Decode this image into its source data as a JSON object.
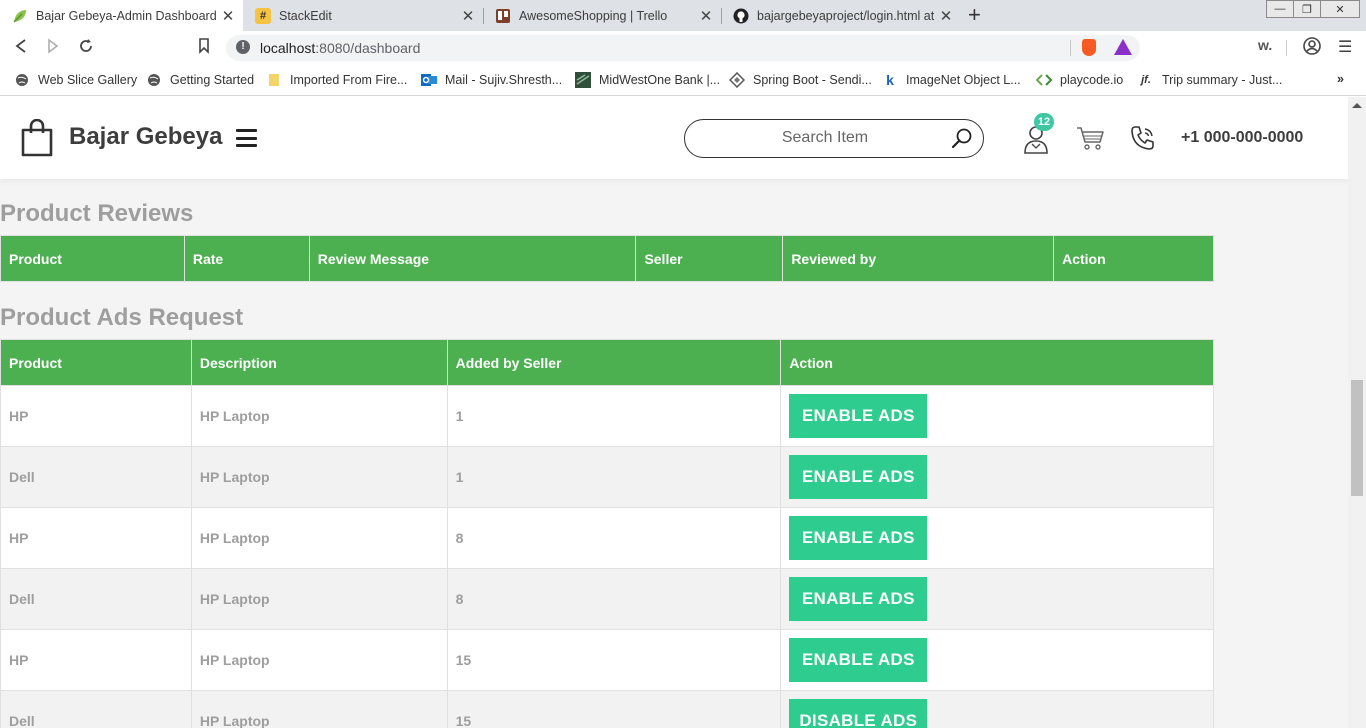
{
  "browser": {
    "tabs": [
      {
        "title": "Bajar Gebeya-Admin Dashboard",
        "icon": "leaf-icon",
        "active": true
      },
      {
        "title": "StackEdit",
        "icon": "hash-icon",
        "active": false
      },
      {
        "title": "AwesomeShopping | Trello",
        "icon": "trello-icon",
        "active": false
      },
      {
        "title": "bajargebeyaproject/login.html at d",
        "icon": "github-icon",
        "active": false
      }
    ],
    "url_host": "localhost",
    "url_path": ":8080/dashboard",
    "bookmarks": [
      {
        "label": "Web Slice Gallery",
        "icon": "globe-icon"
      },
      {
        "label": "Getting Started",
        "icon": "globe-icon"
      },
      {
        "label": "Imported From Fire...",
        "icon": "folder-icon"
      },
      {
        "label": "Mail - Sujiv.Shresth...",
        "icon": "outlook-icon"
      },
      {
        "label": "MidWestOne Bank |...",
        "icon": "bank-icon"
      },
      {
        "label": "Spring Boot - Sendi...",
        "icon": "diamond-icon"
      },
      {
        "label": "ImageNet Object L...",
        "icon": "k-icon"
      },
      {
        "label": "playcode.io",
        "icon": "code-icon"
      },
      {
        "label": "Trip summary - Just...",
        "icon": "jf-icon"
      }
    ],
    "ext_w": "w."
  },
  "header": {
    "brand": "Bajar Gebeya",
    "search_placeholder": "Search Item",
    "badge_count": "12",
    "phone": "+1 000-000-0000"
  },
  "reviews": {
    "title": "Product Reviews",
    "columns": [
      "Product",
      "Rate",
      "Review Message",
      "Seller",
      "Reviewed by",
      "Action"
    ]
  },
  "ads": {
    "title": "Product Ads Request",
    "columns": [
      "Product",
      "Description",
      "Added by Seller",
      "Action"
    ],
    "rows": [
      {
        "product": "HP",
        "description": "HP Laptop",
        "seller": "1",
        "action": "ENABLE ADS"
      },
      {
        "product": "Dell",
        "description": "HP Laptop",
        "seller": "1",
        "action": "ENABLE ADS"
      },
      {
        "product": "HP",
        "description": "HP Laptop",
        "seller": "8",
        "action": "ENABLE ADS"
      },
      {
        "product": "Dell",
        "description": "HP Laptop",
        "seller": "8",
        "action": "ENABLE ADS"
      },
      {
        "product": "HP",
        "description": "HP Laptop",
        "seller": "15",
        "action": "ENABLE ADS"
      },
      {
        "product": "Dell",
        "description": "HP Laptop",
        "seller": "15",
        "action": "DISABLE ADS"
      }
    ]
  },
  "colors": {
    "header_green": "#4caf50",
    "button_teal": "#2ecc8f",
    "title_grey": "#9e9e9e"
  }
}
